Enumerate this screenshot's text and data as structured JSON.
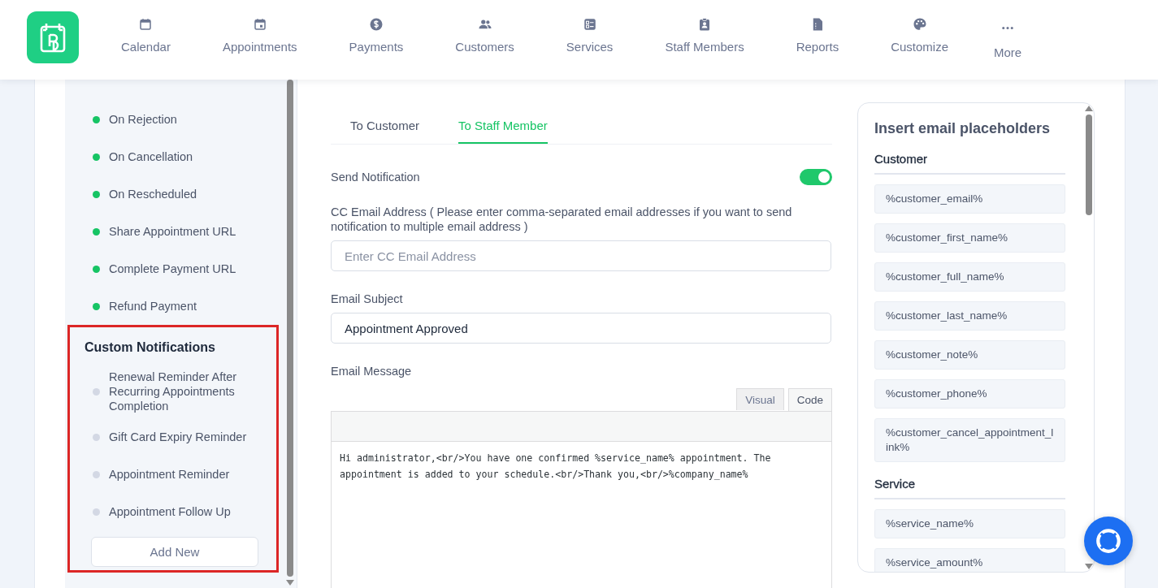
{
  "nav": {
    "items": [
      {
        "label": "Calendar"
      },
      {
        "label": "Appointments"
      },
      {
        "label": "Payments"
      },
      {
        "label": "Customers"
      },
      {
        "label": "Services"
      },
      {
        "label": "Staff Members"
      },
      {
        "label": "Reports"
      },
      {
        "label": "Customize"
      },
      {
        "label": "More"
      }
    ]
  },
  "sidebar": {
    "items": [
      {
        "label": "On Rejection",
        "enabled": true
      },
      {
        "label": "On Cancellation",
        "enabled": true
      },
      {
        "label": "On Rescheduled",
        "enabled": true
      },
      {
        "label": "Share Appointment URL",
        "enabled": true
      },
      {
        "label": "Complete Payment URL",
        "enabled": true
      },
      {
        "label": "Refund Payment",
        "enabled": true
      }
    ],
    "custom_section": {
      "title": "Custom Notifications",
      "highlighted": true,
      "items": [
        {
          "label": "Renewal Reminder After Recurring Appointments Completion",
          "enabled": false
        },
        {
          "label": "Gift Card Expiry Reminder",
          "enabled": false
        },
        {
          "label": "Appointment Reminder",
          "enabled": false
        },
        {
          "label": "Appointment Follow Up",
          "enabled": false
        }
      ],
      "add_button": "Add New"
    }
  },
  "main": {
    "tabs": [
      {
        "label": "To Customer",
        "selected": false
      },
      {
        "label": "To Staff Member",
        "selected": true
      }
    ],
    "send_notification": {
      "label": "Send Notification",
      "on": true
    },
    "cc_email": {
      "label": "CC Email Address ( Please enter comma-separated email addresses if you want to send notification to multiple email address )",
      "placeholder": "Enter CC Email Address"
    },
    "email_subject": {
      "label": "Email Subject",
      "value": "Appointment Approved"
    },
    "email_message": {
      "label": "Email Message",
      "editor_tabs": [
        {
          "label": "Visual",
          "selected": false
        },
        {
          "label": "Code",
          "selected": true
        }
      ],
      "value": "Hi administrator,<br/>You have one confirmed %service_name% appointment. The appointment is added to your schedule.<br/>Thank you,<br/>%company_name%"
    }
  },
  "placeholders": {
    "title": "Insert email placeholders",
    "groups": [
      {
        "title": "Customer",
        "items": [
          "%customer_email%",
          "%customer_first_name%",
          "%customer_full_name%",
          "%customer_last_name%",
          "%customer_note%",
          "%customer_phone%",
          "%customer_cancel_appointment_link%"
        ]
      },
      {
        "title": "Service",
        "items": [
          "%service_name%",
          "%service_amount%"
        ]
      }
    ]
  }
}
